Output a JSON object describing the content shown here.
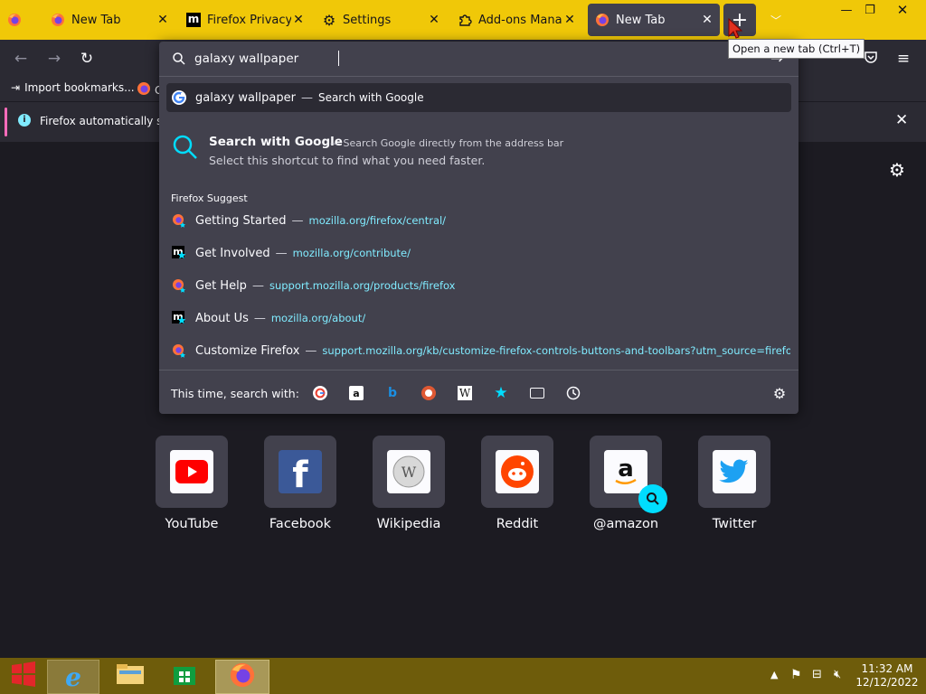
{
  "tabs": [
    {
      "label": "",
      "icon": "firefox-icon"
    },
    {
      "label": "New Tab",
      "icon": "firefox-icon"
    },
    {
      "label": "Firefox Privacy No",
      "icon": "mozilla-icon"
    },
    {
      "label": "Settings",
      "icon": "gear-icon"
    },
    {
      "label": "Add-ons Manager",
      "icon": "puzzle-icon"
    },
    {
      "label": "New Tab",
      "icon": "firefox-icon",
      "active": true
    }
  ],
  "tooltip": "Open a new tab (Ctrl+T)",
  "urlbar": {
    "value": "galaxy wallpaper",
    "search_suggestion": {
      "term": "galaxy wallpaper",
      "action": "Search with Google"
    }
  },
  "bookmarks": {
    "import_label": "Import bookmarks...",
    "second_label": "G"
  },
  "infobar": {
    "text": "Firefox automatically sen"
  },
  "shortcut": {
    "title": "Search with Google",
    "desc": "Search Google directly from the address bar",
    "sub": "Select this shortcut to find what you need faster."
  },
  "suggest": {
    "header": "Firefox Suggest",
    "items": [
      {
        "bold": "G",
        "rest": "etting Started",
        "boldmid": "g",
        "title_full": "Getting Started",
        "url": "mozilla.org/firefox/central/",
        "icon": "firefox-icon"
      },
      {
        "title": "Get Involved",
        "url": "mozilla.org/contribute/",
        "icon": "mozilla-icon"
      },
      {
        "title": "Get Help",
        "url": "support.mozilla.org/products/firefox",
        "icon": "firefox-icon"
      },
      {
        "title": "About Us",
        "url": "mozilla.org/about/",
        "icon": "mozilla-icon"
      },
      {
        "title": "Customize Firefox",
        "url": "support.mozilla.org/kb/customize-firefox-controls-buttons-and-toolbars?utm_source=firefox-bro",
        "icon": "firefox-icon"
      }
    ]
  },
  "search_with": {
    "label": "This time, search with:",
    "engines": [
      "google-icon",
      "amazon-icon",
      "bing-icon",
      "duckduckgo-icon",
      "wikipedia-icon",
      "bookmarks-star-icon",
      "tabs-icon",
      "history-clock-icon"
    ]
  },
  "top_sites": [
    {
      "name": "YouTube",
      "icon": "youtube-icon"
    },
    {
      "name": "Facebook",
      "icon": "facebook-icon"
    },
    {
      "name": "Wikipedia",
      "icon": "wikipedia-icon"
    },
    {
      "name": "Reddit",
      "icon": "reddit-icon"
    },
    {
      "name": "@amazon",
      "icon": "amazon-icon"
    },
    {
      "name": "Twitter",
      "icon": "twitter-icon"
    }
  ],
  "clock": {
    "time": "11:32 AM",
    "date": "12/12/2022"
  },
  "colors": {
    "tabstrip": "#f0c808",
    "toolbar": "#2b2a33",
    "panel": "#42414d",
    "accent": "#00ddff",
    "taskbar": "#6e5c0b"
  }
}
